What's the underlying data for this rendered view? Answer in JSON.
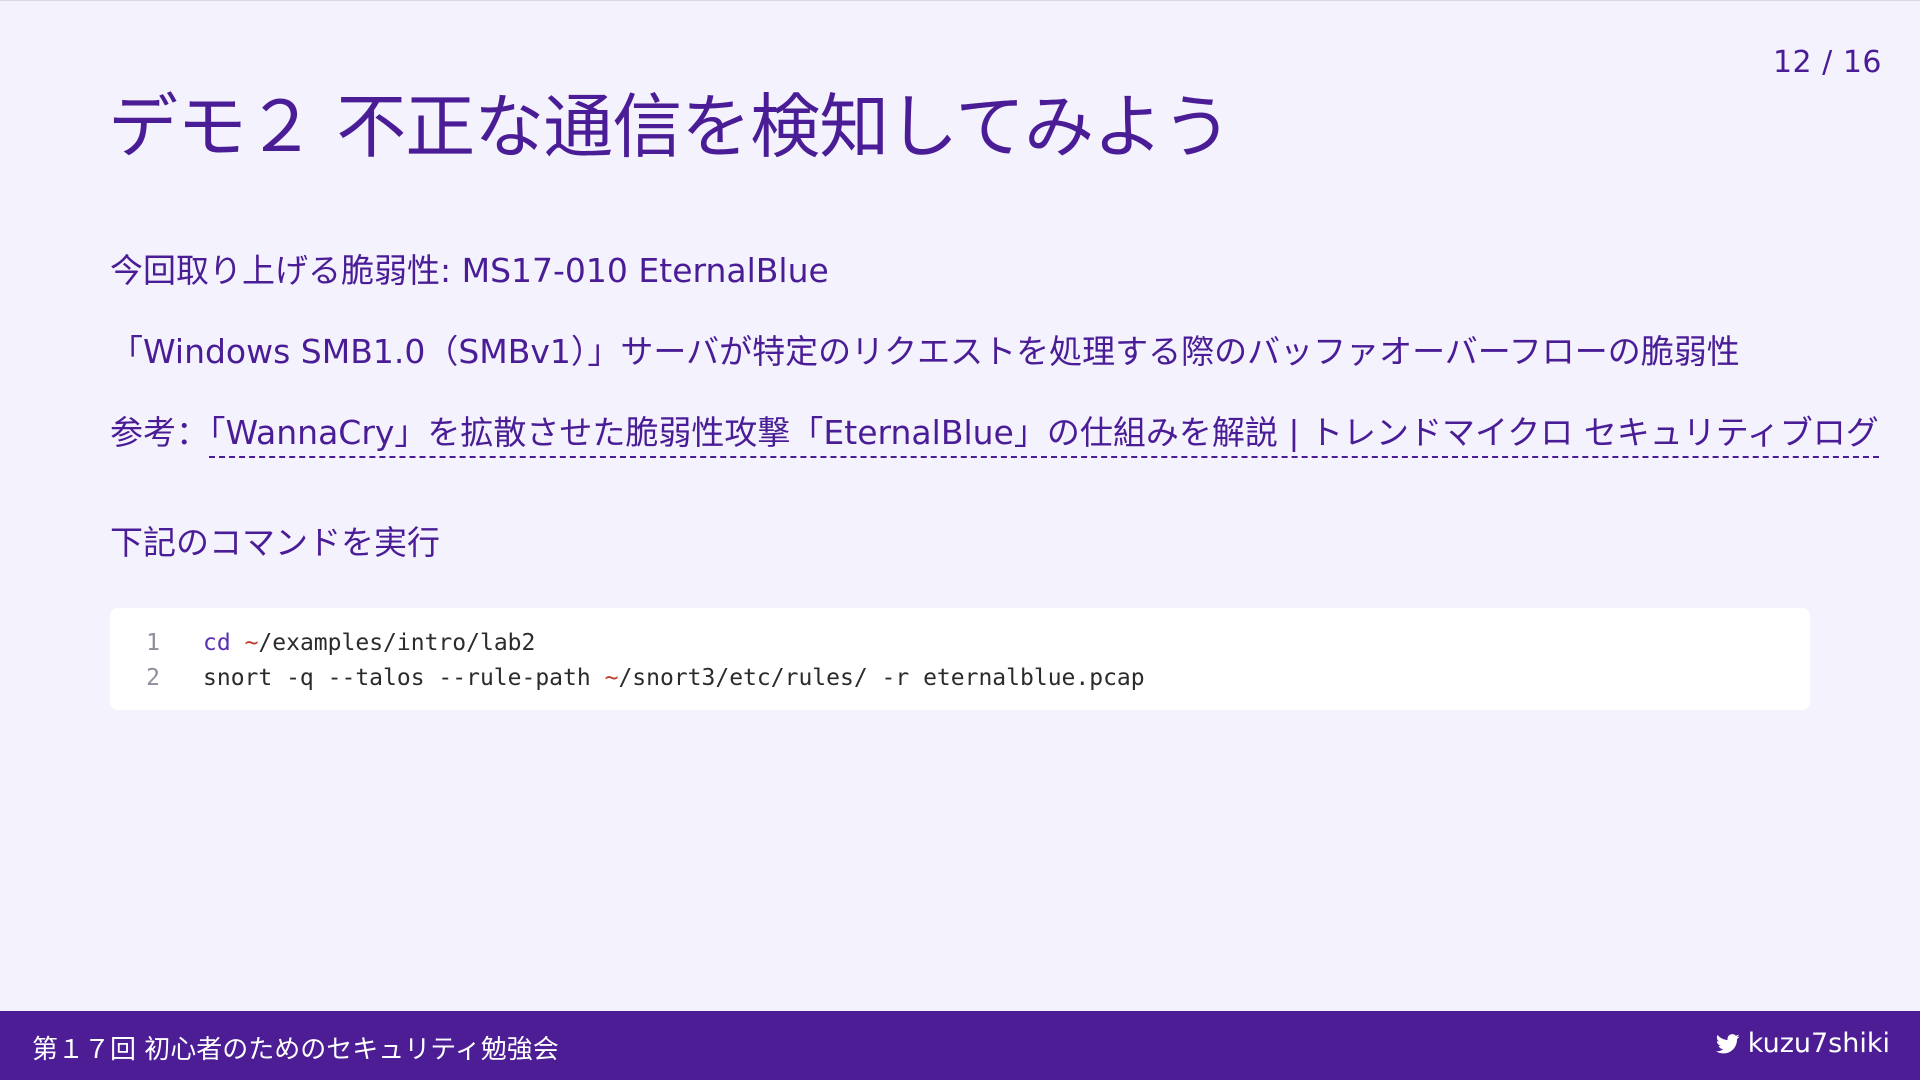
{
  "page_number": "12 / 16",
  "title": "デモ２ 不正な通信を検知してみよう",
  "vuln": {
    "label": "今回取り上げる脆弱性: ",
    "name": "MS17-010 EternalBlue"
  },
  "description": "「Windows SMB1.0（SMBv1）」サーバが特定のリクエストを処理する際のバッファオーバーフローの脆弱性",
  "reference": {
    "label": "参考：",
    "link_text": "「WannaCry」を拡散させた脆弱性攻撃「EternalBlue」の仕組みを解説 | トレンドマイクロ セキュリティブログ"
  },
  "instruction": "下記のコマンドを実行",
  "code": {
    "lines": [
      {
        "no": "1",
        "cmd": "cd",
        "tilde": "~",
        "rest": "/examples/intro/lab2"
      },
      {
        "no": "2",
        "cmd": "snort -q --talos --rule-path ",
        "tilde": "~",
        "rest": "/snort3/etc/rules/ -r eternalblue.pcap"
      }
    ]
  },
  "footer": {
    "event": "第１７回 初心者のためのセキュリティ勉強会",
    "handle": "kuzu7shiki",
    "icon": "twitter-icon"
  },
  "colors": {
    "accent": "#4a1d96",
    "background": "#f4f2fd",
    "footer_bg": "#4c1d95",
    "code_bg": "#ffffff",
    "tilde": "#c0392b"
  }
}
